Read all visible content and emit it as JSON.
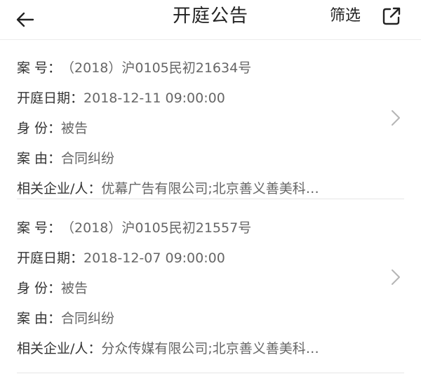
{
  "navbar": {
    "title": "开庭公告",
    "filter_label": "筛选",
    "back_icon": "arrow-left-icon",
    "share_icon": "share-icon"
  },
  "labels": {
    "case_no": "案  号：",
    "hearing_date": "开庭日期：",
    "role": "身  份：",
    "cause": "案  由：",
    "parties": "相关企业/人："
  },
  "cards": [
    {
      "case_no": "（2018）沪0105民初21634号",
      "hearing_date": "2018-12-11 09:00:00",
      "role": "被告",
      "cause": "合同纠纷",
      "parties": "优幕广告有限公司;北京善义善美科…"
    },
    {
      "case_no": "（2018）沪0105民初21557号",
      "hearing_date": "2018-12-07 09:00:00",
      "role": "被告",
      "cause": "合同纠纷",
      "parties": "分众传媒有限公司;北京善义善美科…"
    }
  ],
  "colors": {
    "text_primary": "#333333",
    "text_secondary": "#666666",
    "divider": "#e6e6e6"
  }
}
